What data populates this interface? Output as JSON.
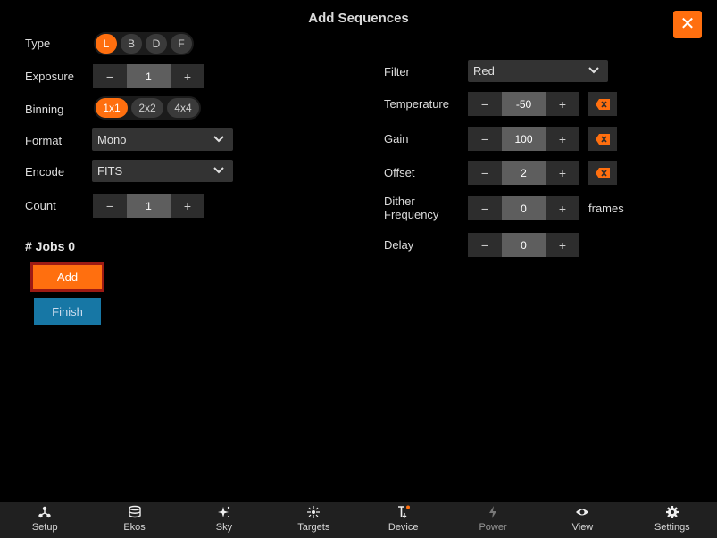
{
  "dialog": {
    "title": "Add Sequences",
    "close_label": "✕"
  },
  "left": {
    "type": {
      "label": "Type",
      "options": [
        "L",
        "B",
        "D",
        "F"
      ],
      "selected": "L"
    },
    "exposure": {
      "label": "Exposure",
      "minus": "−",
      "value": "1",
      "plus": "+"
    },
    "binning": {
      "label": "Binning",
      "options": [
        "1x1",
        "2x2",
        "4x4"
      ],
      "selected": "1x1"
    },
    "format": {
      "label": "Format",
      "value": "Mono"
    },
    "encode": {
      "label": "Encode",
      "value": "FITS"
    },
    "count": {
      "label": "Count",
      "minus": "−",
      "value": "1",
      "plus": "+"
    },
    "jobs": "# Jobs 0",
    "add_label": "Add",
    "finish_label": "Finish"
  },
  "right": {
    "filter": {
      "label": "Filter",
      "value": "Red"
    },
    "temperature": {
      "label": "Temperature",
      "minus": "−",
      "value": "-50",
      "plus": "+"
    },
    "gain": {
      "label": "Gain",
      "minus": "−",
      "value": "100",
      "plus": "+"
    },
    "offset": {
      "label": "Offset",
      "minus": "−",
      "value": "2",
      "plus": "+"
    },
    "dither": {
      "label_line1": "Dither",
      "label_line2": "Frequency",
      "minus": "−",
      "value": "0",
      "plus": "+",
      "unit": "frames"
    },
    "delay": {
      "label": "Delay",
      "minus": "−",
      "value": "0",
      "plus": "+"
    }
  },
  "nav": {
    "items": [
      {
        "label": "Setup",
        "icon": "setup-icon"
      },
      {
        "label": "Ekos",
        "icon": "ekos-icon"
      },
      {
        "label": "Sky",
        "icon": "sky-icon"
      },
      {
        "label": "Targets",
        "icon": "targets-icon"
      },
      {
        "label": "Device",
        "icon": "device-icon"
      },
      {
        "label": "Power",
        "icon": "power-icon"
      },
      {
        "label": "View",
        "icon": "view-icon"
      },
      {
        "label": "Settings",
        "icon": "settings-icon"
      }
    ]
  },
  "colors": {
    "accent": "#ff6f0f",
    "finish": "#1777a5",
    "add_border": "#9d1a14",
    "background": "#000000"
  }
}
